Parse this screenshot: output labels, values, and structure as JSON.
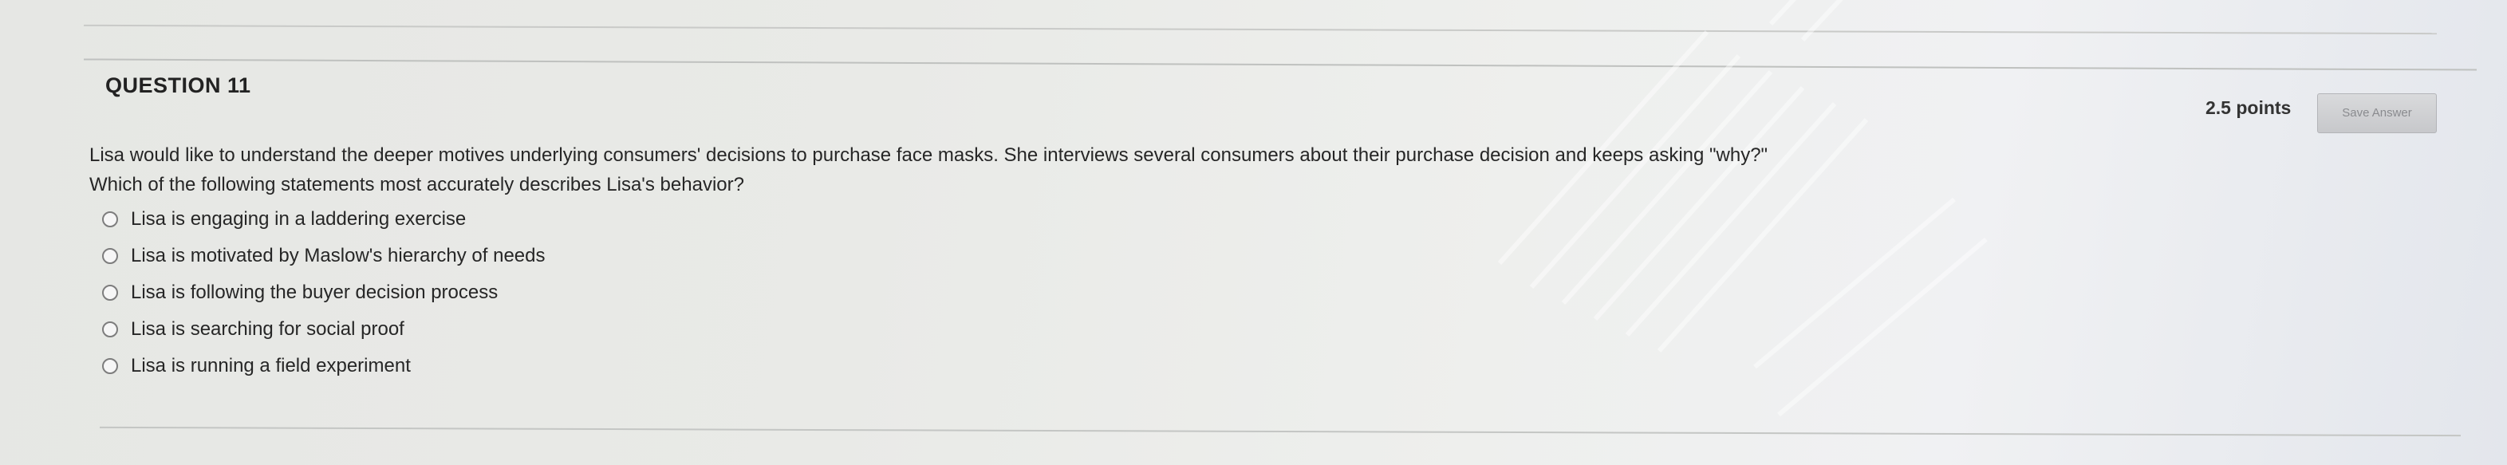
{
  "question": {
    "title": "QUESTION 11",
    "points": "2.5 points",
    "save_label": "Save Answer",
    "text_line1": "Lisa would like to understand the deeper motives underlying consumers' decisions to purchase face masks. She interviews several consumers about their purchase decision and keeps asking \"why?\"",
    "text_line2": "Which of the following statements most accurately describes Lisa's behavior?",
    "options": [
      {
        "label": "Lisa is engaging in a laddering exercise"
      },
      {
        "label": "Lisa is motivated by Maslow's hierarchy of needs"
      },
      {
        "label": "Lisa is following the buyer decision process"
      },
      {
        "label": "Lisa is searching for social proof"
      },
      {
        "label": "Lisa is running a field experiment"
      }
    ]
  }
}
